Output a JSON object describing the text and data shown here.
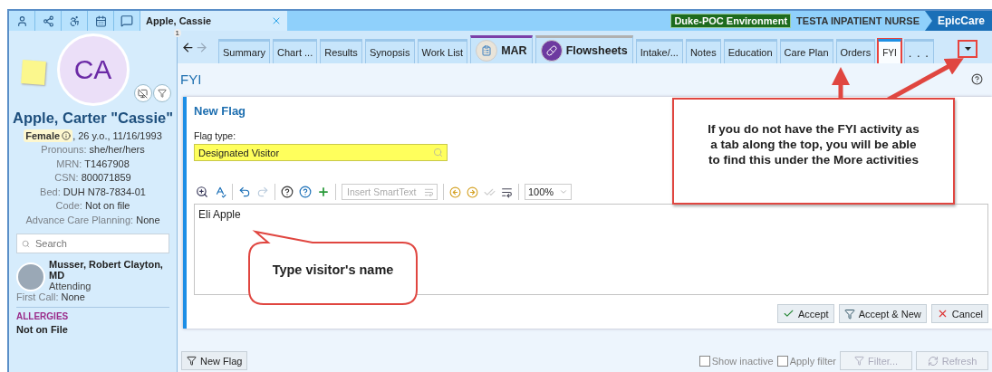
{
  "top_bar": {
    "patient_tab": "Apple, Cassie",
    "environment": "Duke-POC Environment",
    "user_role": "TESTA INPATIENT NURSE",
    "app_name": "EpicCare"
  },
  "sidebar": {
    "initials": "CA",
    "flag_count": "1",
    "name": "Apple, Carter \"Cassie\"",
    "sex": "Female",
    "demographics": ", 26 y.o., 11/16/1993",
    "details": [
      {
        "label": "Pronouns:",
        "value": "she/her/hers"
      },
      {
        "label": "MRN:",
        "value": "T1467908"
      },
      {
        "label": "CSN:",
        "value": "800071859"
      },
      {
        "label": "Bed:",
        "value": "DUH N78-7834-01"
      },
      {
        "label": "Code:",
        "value": "Not on file"
      },
      {
        "label": "Advance Care Planning:",
        "value": "None"
      }
    ],
    "search": {
      "placeholder": "Search"
    },
    "provider": {
      "name": "Musser, Robert Clayton, MD",
      "role": "Attending"
    },
    "first_call": {
      "label": "First Call:",
      "value": "None"
    },
    "allergies": {
      "heading": "ALLERGIES",
      "value": "Not on File"
    }
  },
  "tabs": [
    {
      "label": "Summary",
      "kind": "text",
      "selected": false
    },
    {
      "label": "Chart ...",
      "kind": "text",
      "selected": false
    },
    {
      "label": "Results",
      "kind": "text",
      "selected": false
    },
    {
      "label": "Synopsis",
      "kind": "text",
      "selected": false
    },
    {
      "label": "Work List",
      "kind": "text",
      "selected": false
    },
    {
      "label": "MAR",
      "kind": "icon",
      "color": "#7b3fa8",
      "selected": false
    },
    {
      "label": "Flowsheets",
      "kind": "icon",
      "color": "#b0b0b0",
      "selected": false
    },
    {
      "label": "Intake/...",
      "kind": "text",
      "selected": false
    },
    {
      "label": "Notes",
      "kind": "text",
      "selected": false
    },
    {
      "label": "Education",
      "kind": "text",
      "selected": false
    },
    {
      "label": "Care Plan",
      "kind": "text",
      "selected": false
    },
    {
      "label": "Orders",
      "kind": "text",
      "selected": false
    },
    {
      "label": "FYI",
      "kind": "text",
      "selected": true
    },
    {
      "label": ". . .",
      "kind": "more",
      "selected": false
    }
  ],
  "activity": {
    "title": "FYI",
    "form": {
      "title": "New Flag",
      "flag_type_label": "Flag type:",
      "flag_type": "Designated Visitor",
      "smarttext_placeholder": "Insert SmartText",
      "zoom": "100%",
      "note": "Eli Apple",
      "buttons": [
        {
          "label": "Accept",
          "kind": "accept"
        },
        {
          "label": "Accept & New",
          "kind": "accept_new"
        },
        {
          "label": "Cancel",
          "kind": "cancel"
        }
      ]
    },
    "footer": {
      "new_flag": "New Flag",
      "checkboxes": [
        {
          "label": "Show inactive",
          "checked": false
        },
        {
          "label": "Apply filter",
          "checked": false
        }
      ],
      "buttons": [
        {
          "label": "Filter...",
          "kind": "filter",
          "disabled": true
        },
        {
          "label": "Refresh",
          "kind": "refresh",
          "disabled": true
        }
      ]
    }
  },
  "annotations": [
    {
      "kind": "box",
      "text": "If you do not have the FYI activity as a tab along the top, you will be able to find this under the More activities"
    },
    {
      "kind": "bubble",
      "text": "Type visitor's name"
    }
  ]
}
